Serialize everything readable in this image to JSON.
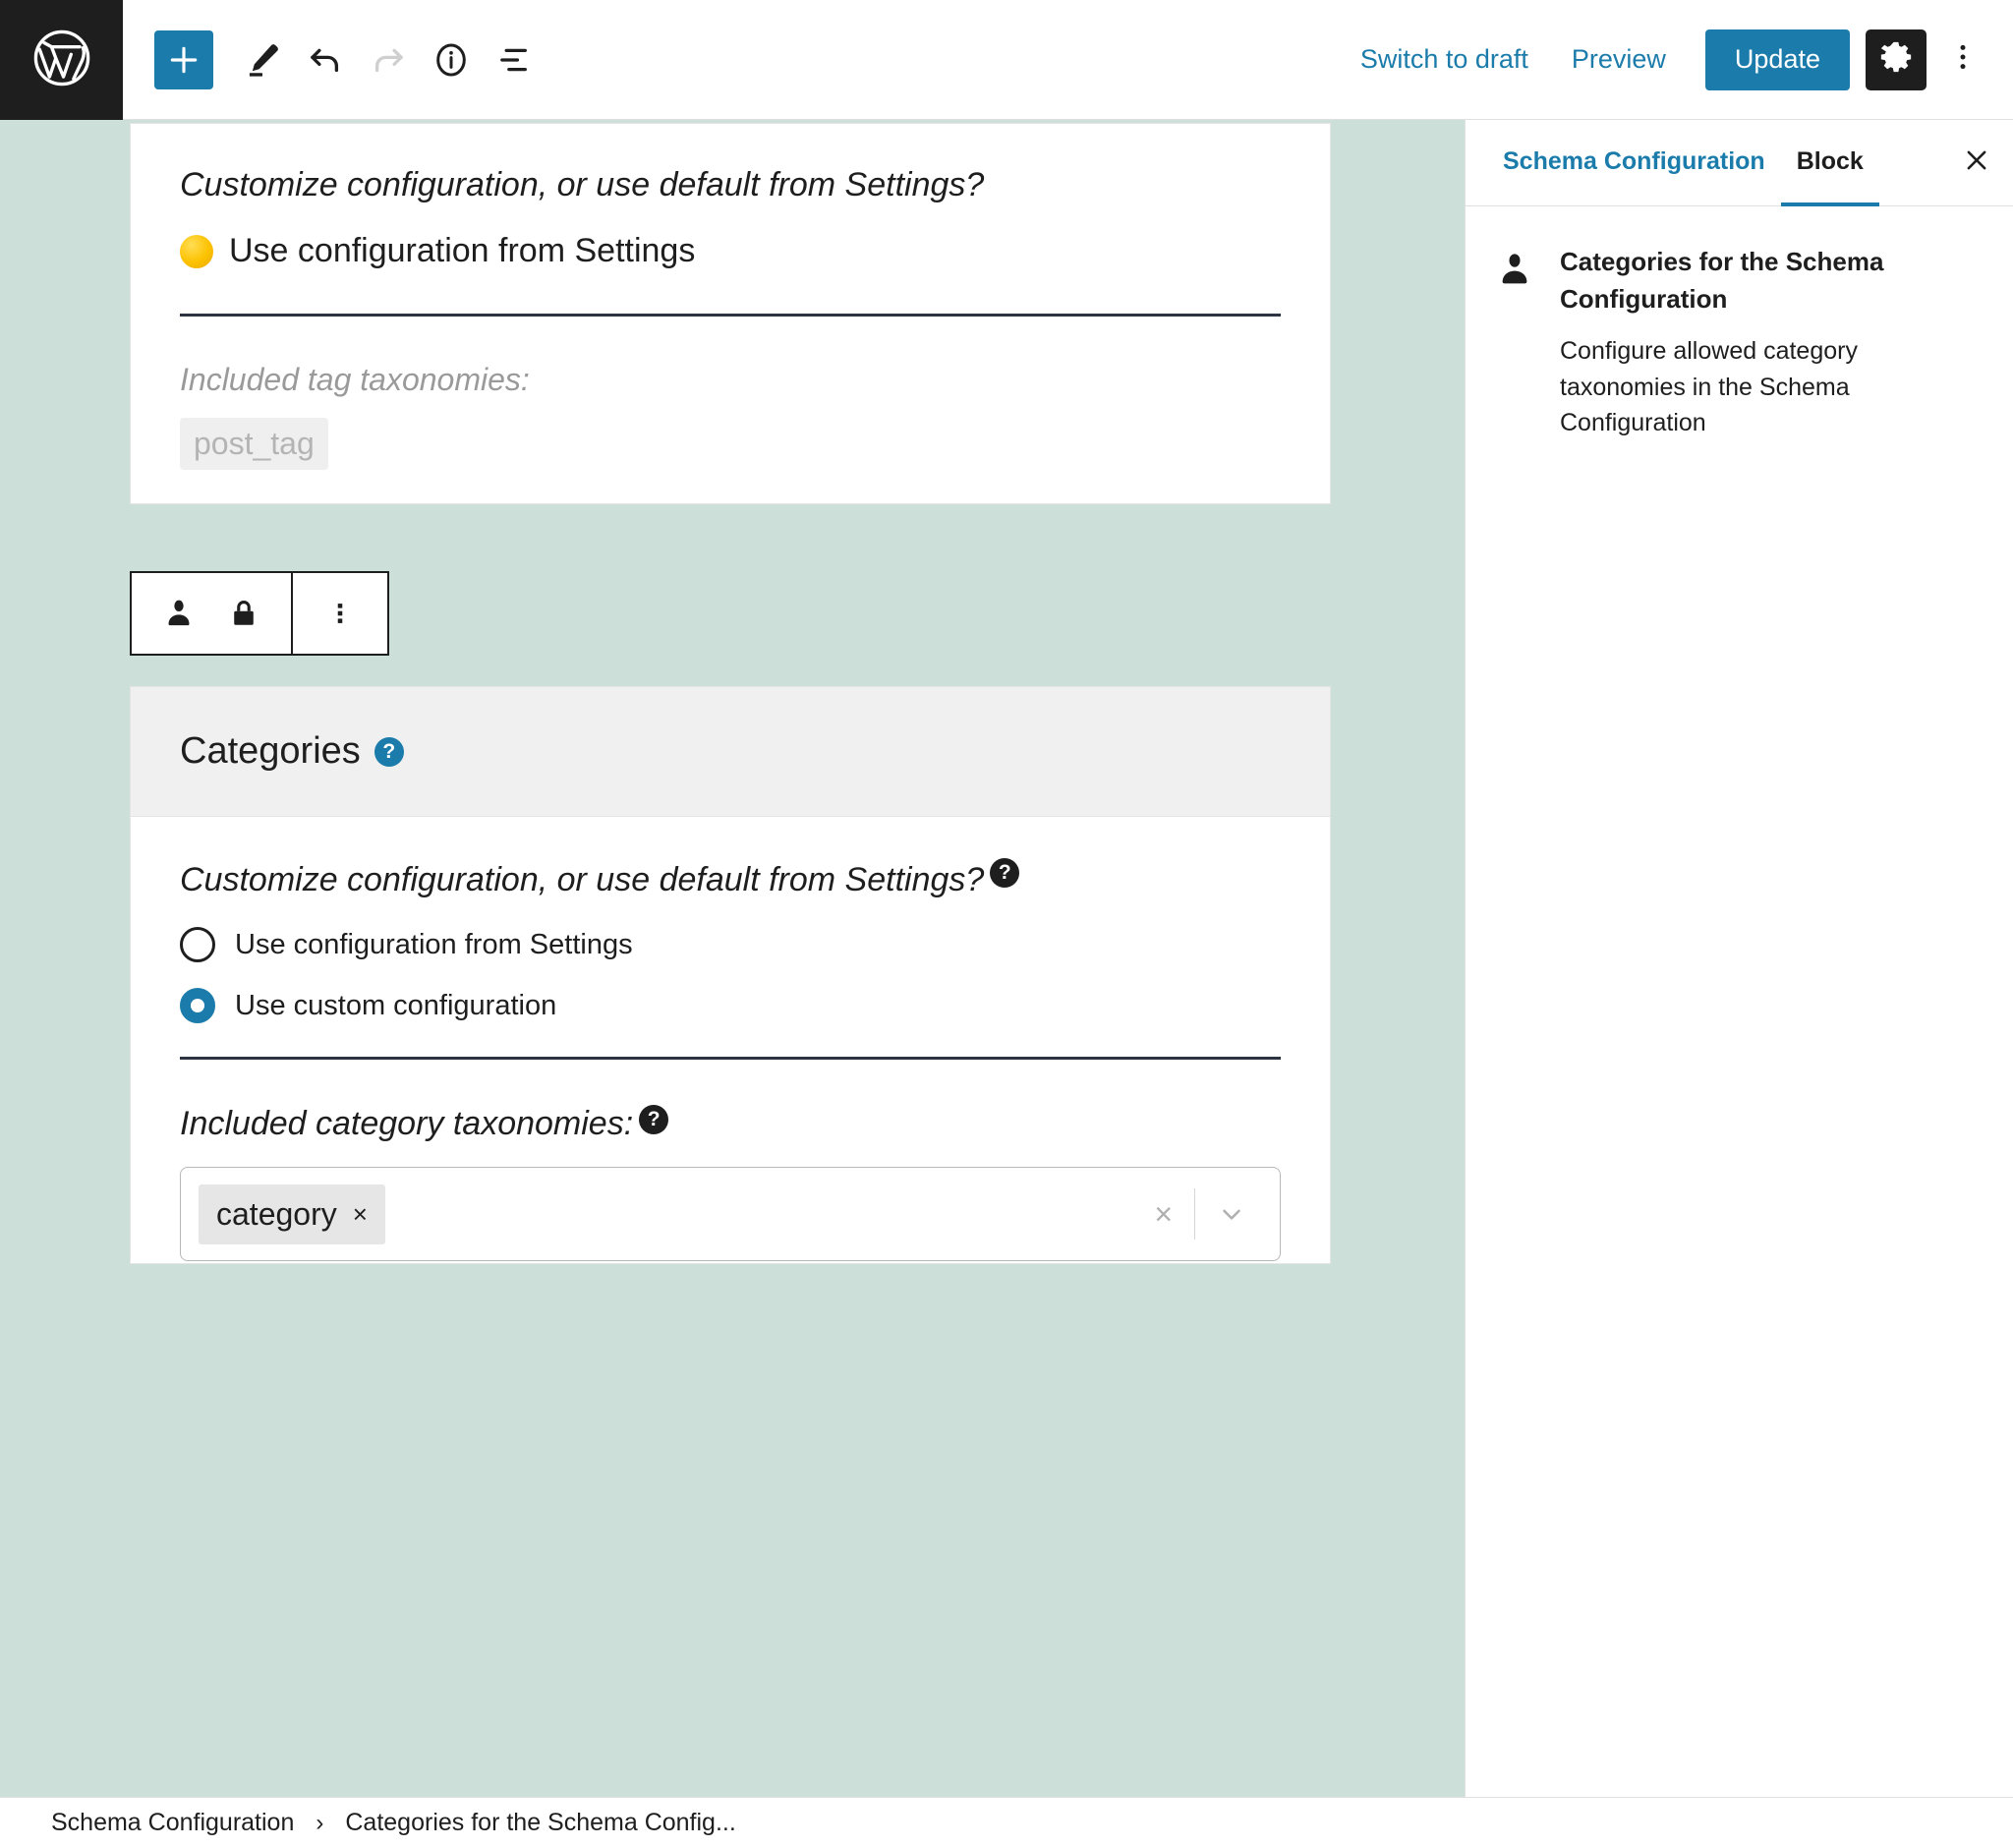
{
  "header": {
    "wp_logo_icon": "wordpress-logo-icon",
    "tools": [
      {
        "name": "block-inserter-button",
        "icon": "plus-icon",
        "state": "primary"
      },
      {
        "name": "tools-pencil-button",
        "icon": "pencil-icon",
        "state": "normal"
      },
      {
        "name": "undo-button",
        "icon": "undo-icon",
        "state": "normal"
      },
      {
        "name": "redo-button",
        "icon": "redo-icon",
        "state": "disabled"
      },
      {
        "name": "details-info-button",
        "icon": "info-circle-icon",
        "state": "normal"
      },
      {
        "name": "list-view-button",
        "icon": "list-view-icon",
        "state": "normal"
      }
    ],
    "switch_to_draft_label": "Switch to draft",
    "preview_label": "Preview",
    "update_label": "Update",
    "settings_icon": "gear-icon",
    "options_icon": "kebab-menu-icon",
    "accent_color": "#1b7cab",
    "dark_color": "#1e1e1e"
  },
  "canvas": {
    "background_color": "#cddfd9",
    "tag_block": {
      "question": "Customize configuration, or use default from Settings?",
      "selected_option_emoji": "🟡",
      "selected_option_label": "Use configuration from Settings",
      "taxonomies_label": "Included tag taxonomies:",
      "chip_label": "post_tag"
    },
    "block_toolbar": {
      "user_lock_icons": [
        "person-icon",
        "lock-icon"
      ],
      "options_icon": "kebab-menu-icon"
    },
    "categories_block": {
      "title": "Categories",
      "title_help_icon": "help-question-icon",
      "question": "Customize configuration, or use default from Settings?",
      "question_help_icon": "help-question-icon",
      "options": [
        {
          "label": "Use configuration from Settings",
          "checked": false
        },
        {
          "label": "Use custom configuration",
          "checked": true
        }
      ],
      "taxonomies_label": "Included category taxonomies:",
      "taxonomies_help_icon": "help-question-icon",
      "selected_chips": [
        {
          "label": "category",
          "remove_icon": "×"
        }
      ],
      "clear_all_icon": "×",
      "dropdown_icon": "chevron-down-icon"
    }
  },
  "sidebar": {
    "tabs": [
      {
        "label": "Schema Configuration",
        "active": false
      },
      {
        "label": "Block",
        "active": true
      }
    ],
    "close_icon": "close-icon",
    "panel": {
      "icon": "person-icon",
      "title": "Categories for the Schema Configuration",
      "description": "Configure allowed category taxonomies in the Schema Configuration"
    }
  },
  "footer": {
    "breadcrumbs": [
      {
        "label": "Schema Configuration"
      },
      {
        "label": "Categories for the Schema Config..."
      }
    ],
    "separator": "›"
  }
}
